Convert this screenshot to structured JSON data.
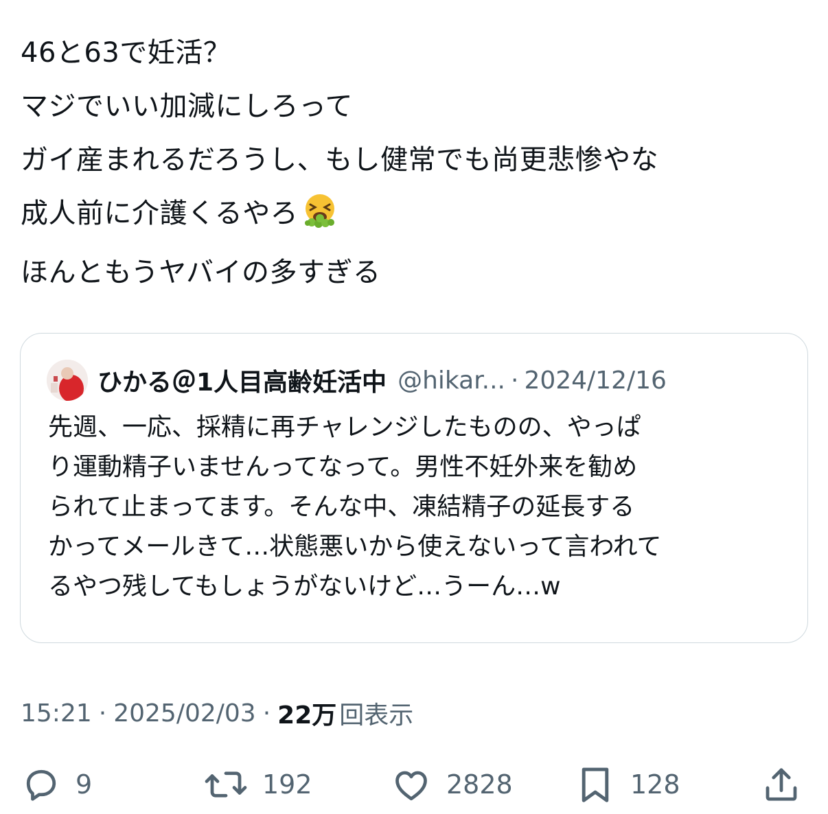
{
  "post": {
    "lines": [
      "46と63で妊活？",
      "マジでいい加減にしろって",
      "ガイ産まれるだろうし、もし健常でも尚更悲惨やな",
      "成人前に介護くるやろ",
      "ほんともうヤバイの多すぎる"
    ],
    "emoji": "face-vomiting-emoji"
  },
  "quote": {
    "name": "ひかる＠1人目高齢妊活中",
    "handle": "@hikar...",
    "dot": "·",
    "date": "2024/12/16",
    "body_lines": [
      "先週、一応、採精に再チャレンジしたものの、やっぱ",
      "り運動精子いませんってなって。男性不妊外来を勧め",
      "られて止まってます。そんな中、凍結精子の延長する",
      "かってメールきて…状態悪いから使えないって言われて",
      "るやつ残してもしょうがないけど…うーん…w"
    ]
  },
  "meta": {
    "time": "15:21",
    "dot": "·",
    "date": "2025/02/03",
    "views_num": "22万",
    "views_label": "回表示"
  },
  "actions": {
    "reply": {
      "icon": "reply-icon",
      "count": "9"
    },
    "retweet": {
      "icon": "retweet-icon",
      "count": "192"
    },
    "like": {
      "icon": "heart-icon",
      "count": "2828"
    },
    "bookmark": {
      "icon": "bookmark-icon",
      "count": "128"
    },
    "share": {
      "icon": "share-icon"
    }
  },
  "colors": {
    "text": "#0f1419",
    "secondary": "#536471",
    "border": "#cfd9de"
  }
}
